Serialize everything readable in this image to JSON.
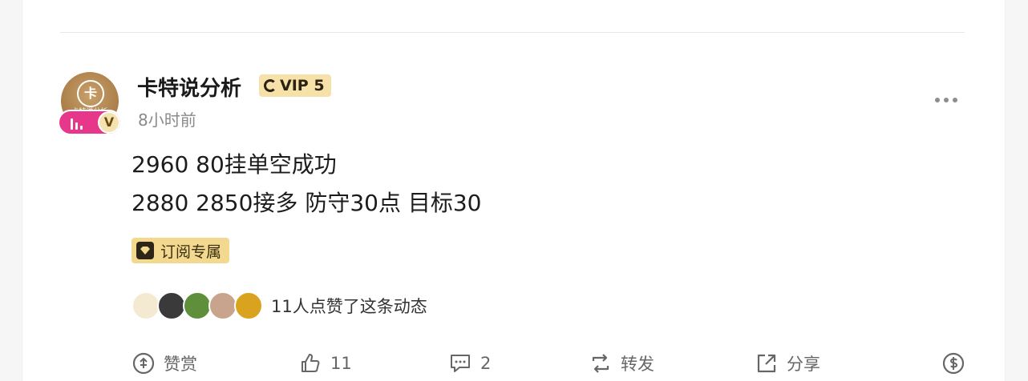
{
  "post": {
    "author": "卡特说分析",
    "avatar_text": "卡特说分析",
    "avatar_logo": "卡",
    "verified_badge": "V",
    "vip_label": "VIP 5",
    "time": "8小时前",
    "lines": [
      "2960 80挂单空成功",
      "2880 2850接多 防守30点 目标30"
    ],
    "tag": "订阅专属",
    "likes_text": "11人点赞了这条动态"
  },
  "likers": [
    {
      "icon": "bear-avatar",
      "color": "#f3ead1"
    },
    {
      "icon": "person-avatar",
      "color": "#3a3a3a"
    },
    {
      "icon": "nature-avatar",
      "color": "#5f8f3a"
    },
    {
      "icon": "person-avatar",
      "color": "#c7a48b"
    },
    {
      "icon": "sunflower-avatar",
      "color": "#d9a21f"
    }
  ],
  "actions": {
    "tip_label": "赞赏",
    "like_count": "11",
    "comment_count": "2",
    "repost_label": "转发",
    "share_label": "分享"
  },
  "colors": {
    "vip_bg": "#f6e2a8",
    "tag_bg": "#f3d98f",
    "live_badge": "#e6378a",
    "avatar": "#b58a55"
  }
}
